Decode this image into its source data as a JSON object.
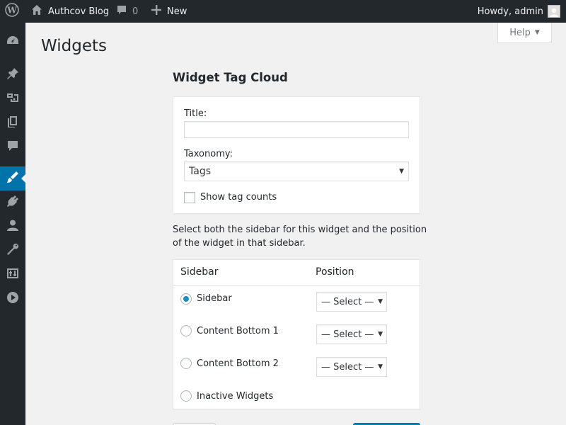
{
  "adminbar": {
    "site_name": "Authcov Blog",
    "comment_count": "0",
    "new_label": "New",
    "howdy": "Howdy, admin"
  },
  "sidebar_menu": [
    {
      "icon": "dashboard-icon"
    },
    {
      "icon": "pushpin-icon"
    },
    {
      "icon": "media-icon"
    },
    {
      "icon": "pages-icon"
    },
    {
      "icon": "comments-icon"
    },
    {
      "icon": "appearance-icon",
      "current": true
    },
    {
      "icon": "plugins-icon"
    },
    {
      "icon": "users-icon"
    },
    {
      "icon": "tools-icon"
    },
    {
      "icon": "settings-icon"
    },
    {
      "icon": "play-icon"
    }
  ],
  "help_label": "Help",
  "page_title": "Widgets",
  "widget_title": "Widget Tag Cloud",
  "form": {
    "title_label": "Title:",
    "title_value": "",
    "taxonomy_label": "Taxonomy:",
    "taxonomy_value": "Tags",
    "show_counts_label": "Show tag counts",
    "show_counts_checked": false
  },
  "help_text": "Select both the sidebar for this widget and the position of the widget in that sidebar.",
  "sidebar_table": {
    "col_sidebar": "Sidebar",
    "col_position": "Position",
    "rows": [
      {
        "name": "Sidebar",
        "checked": true,
        "position": "— Select —"
      },
      {
        "name": "Content Bottom 1",
        "checked": false,
        "position": "— Select —"
      },
      {
        "name": "Content Bottom 2",
        "checked": false,
        "position": "— Select —"
      },
      {
        "name": "Inactive Widgets",
        "checked": false
      }
    ]
  },
  "colors": {
    "adminbar_bg": "#23282d",
    "accent": "#0073aa",
    "page_bg": "#f1f1f1"
  }
}
